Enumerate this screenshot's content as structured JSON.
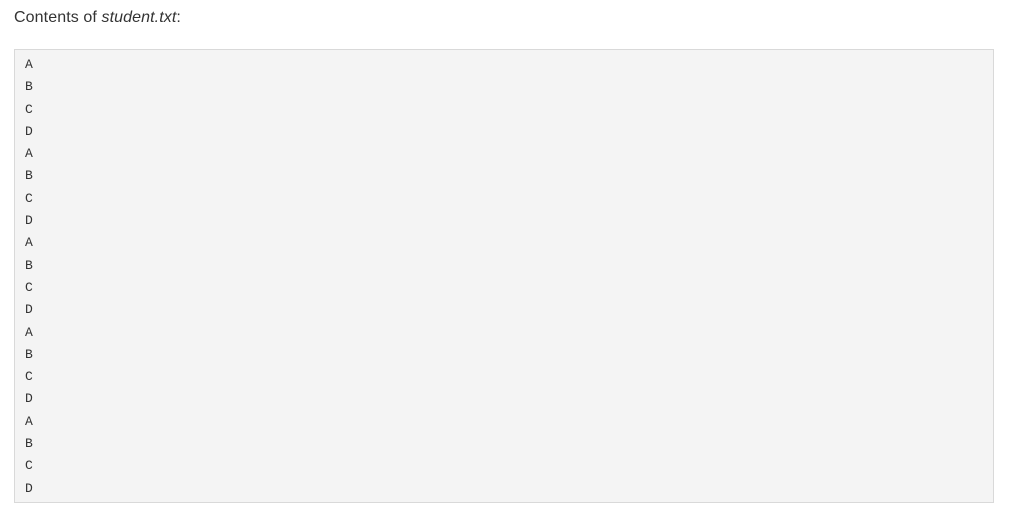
{
  "heading": {
    "prefix": "Contents of ",
    "filename": "student.txt",
    "suffix": ":"
  },
  "file": {
    "lines": [
      "A",
      "B",
      "C",
      "D",
      "A",
      "B",
      "C",
      "D",
      "A",
      "B",
      "C",
      "D",
      "A",
      "B",
      "C",
      "D",
      "A",
      "B",
      "C",
      "D"
    ]
  }
}
